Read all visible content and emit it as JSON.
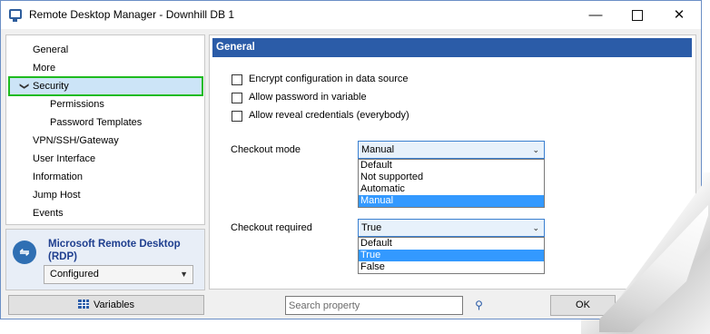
{
  "window": {
    "title": "Remote Desktop Manager - Downhill DB 1",
    "controls": {
      "minimize": "—",
      "maximize": "",
      "close": "✕"
    }
  },
  "nav": {
    "items": [
      {
        "label": "General",
        "indent": 0,
        "selected": false
      },
      {
        "label": "More",
        "indent": 0,
        "selected": false
      },
      {
        "label": "Security",
        "indent": 0,
        "selected": true,
        "expanded": true
      },
      {
        "label": "Permissions",
        "indent": 1,
        "selected": false
      },
      {
        "label": "Password Templates",
        "indent": 1,
        "selected": false
      },
      {
        "label": "VPN/SSH/Gateway",
        "indent": 0,
        "selected": false
      },
      {
        "label": "User Interface",
        "indent": 0,
        "selected": false
      },
      {
        "label": "Information",
        "indent": 0,
        "selected": false
      },
      {
        "label": "Jump Host",
        "indent": 0,
        "selected": false
      },
      {
        "label": "Events",
        "indent": 0,
        "selected": false
      }
    ],
    "expand_glyph": "❯"
  },
  "session": {
    "name": "Microsoft Remote Desktop (RDP)",
    "icon": "rdp-icon",
    "status_value": "Configured"
  },
  "panel": {
    "header": "General",
    "checkboxes": [
      {
        "label": "Encrypt configuration in data source",
        "checked": false
      },
      {
        "label": "Allow password in variable",
        "checked": false
      },
      {
        "label": "Allow reveal credentials (everybody)",
        "checked": false
      }
    ],
    "checkout_mode": {
      "label": "Checkout mode",
      "value": "Manual",
      "options": [
        "Default",
        "Not supported",
        "Automatic",
        "Manual"
      ],
      "highlighted": "Manual"
    },
    "checkout_required": {
      "label": "Checkout required",
      "value": "True",
      "options": [
        "Default",
        "True",
        "False"
      ],
      "highlighted": "True"
    }
  },
  "bottom": {
    "variables_label": "Variables",
    "search_placeholder": "Search property",
    "ok_label": "OK"
  },
  "colors": {
    "header_blue": "#2b5ca8",
    "selection_blue": "#3399ff",
    "nav_selected_bg": "#cce4f7",
    "highlight_outline": "#1fbb1f"
  }
}
